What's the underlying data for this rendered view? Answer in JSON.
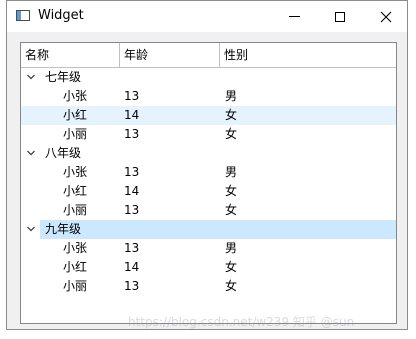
{
  "window": {
    "title": "Widget"
  },
  "tree": {
    "columns": [
      "名称",
      "年龄",
      "性别"
    ],
    "groups": [
      {
        "label": "七年级",
        "children": [
          {
            "name": "小张",
            "age": "13",
            "gender": "男"
          },
          {
            "name": "小红",
            "age": "14",
            "gender": "女"
          },
          {
            "name": "小丽",
            "age": "13",
            "gender": "女"
          }
        ]
      },
      {
        "label": "八年级",
        "children": [
          {
            "name": "小张",
            "age": "13",
            "gender": "男"
          },
          {
            "name": "小红",
            "age": "14",
            "gender": "女"
          },
          {
            "name": "小丽",
            "age": "13",
            "gender": "女"
          }
        ]
      },
      {
        "label": "九年级",
        "children": [
          {
            "name": "小张",
            "age": "13",
            "gender": "男"
          },
          {
            "name": "小红",
            "age": "14",
            "gender": "女"
          },
          {
            "name": "小丽",
            "age": "13",
            "gender": "女"
          }
        ]
      }
    ]
  },
  "watermark": "https://blog.csdn.net/w239 知乎 @sun"
}
